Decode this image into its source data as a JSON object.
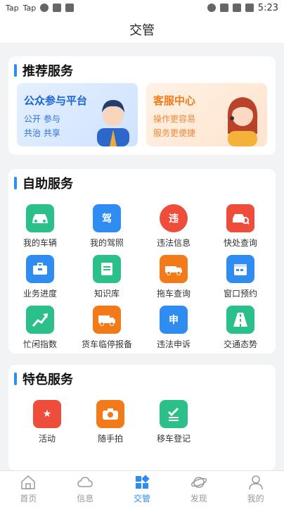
{
  "status_bar": {
    "left_items": [
      "Tap",
      "Tap"
    ],
    "time": "5:23"
  },
  "header": {
    "title": "交管"
  },
  "recommended": {
    "title": "推荐服务",
    "banners": [
      {
        "title": "公众参与平台",
        "line1": "公开  参与",
        "line2": "共治  共享",
        "color": "#1a63d8"
      },
      {
        "title": "客服中心",
        "line1": "操作更容易",
        "line2": "服务更便捷",
        "color": "#f27a19"
      }
    ]
  },
  "self_service": {
    "title": "自助服务",
    "items": [
      {
        "label": "我的车辆",
        "icon": "car-icon",
        "color": "#2bbf8a"
      },
      {
        "label": "我的驾照",
        "icon": "license-icon",
        "color": "#2f8cf0"
      },
      {
        "label": "违法信息",
        "icon": "violation-icon",
        "color": "#ee4d3c"
      },
      {
        "label": "快处查询",
        "icon": "car-search-icon",
        "color": "#ee4d3c"
      },
      {
        "label": "业务进度",
        "icon": "briefcase-icon",
        "color": "#2f8cf0"
      },
      {
        "label": "知识库",
        "icon": "book-icon",
        "color": "#2bbf8a"
      },
      {
        "label": "拖车查询",
        "icon": "tow-truck-icon",
        "color": "#f27a19"
      },
      {
        "label": "窗口预约",
        "icon": "calendar-icon",
        "color": "#2f8cf0"
      },
      {
        "label": "忙闲指数",
        "icon": "trend-icon",
        "color": "#2bbf8a"
      },
      {
        "label": "货车临停报备",
        "icon": "truck-icon",
        "color": "#f27a19"
      },
      {
        "label": "违法申诉",
        "icon": "appeal-icon",
        "color": "#2f8cf0"
      },
      {
        "label": "交通态势",
        "icon": "road-icon",
        "color": "#2bbf8a"
      }
    ]
  },
  "featured": {
    "title": "特色服务",
    "items": [
      {
        "label": "活动",
        "icon": "star-flag-icon",
        "color": "#ee4d3c"
      },
      {
        "label": "随手拍",
        "icon": "camera-icon",
        "color": "#f27a19"
      },
      {
        "label": "移车登记",
        "icon": "checklist-icon",
        "color": "#2bbf8a"
      }
    ]
  },
  "tabbar": {
    "tabs": [
      {
        "label": "首页",
        "icon": "home-icon"
      },
      {
        "label": "信息",
        "icon": "cloud-icon"
      },
      {
        "label": "交管",
        "icon": "grid-icon",
        "active": true
      },
      {
        "label": "发现",
        "icon": "planet-icon"
      },
      {
        "label": "我的",
        "icon": "person-icon"
      }
    ]
  }
}
